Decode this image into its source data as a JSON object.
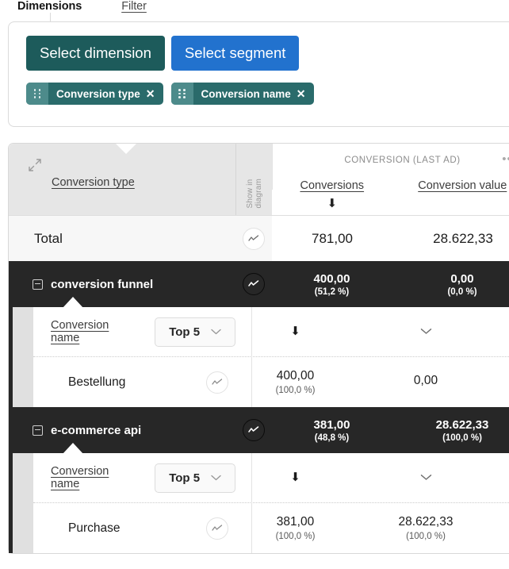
{
  "tabs": {
    "dimensions": "Dimensions",
    "filter": "Filter"
  },
  "panel": {
    "select_dimension": "Select dimension",
    "select_segment": "Select segment",
    "chips": [
      {
        "label": "Conversion type",
        "close": "✕",
        "handle": "drag-handle-icon"
      },
      {
        "label": "Conversion name",
        "close": "✕",
        "handle": "drag-handle-icon"
      }
    ]
  },
  "table": {
    "expand_icon": "expand-diagonal-icon",
    "dimension_header": "Conversion type",
    "show_in_diagram": "Show in\ndiagram",
    "group_header": "CONVERSION (LAST AD)",
    "group_menu": "•••",
    "metrics": [
      {
        "label": "Conversions",
        "sort": "⬇"
      },
      {
        "label": "Conversion value",
        "sort": ""
      }
    ],
    "total_row": {
      "label": "Total",
      "spark": "sparkline-icon",
      "conversions": "781,00",
      "conversion_value": "28.622,33"
    },
    "groups": [
      {
        "name": "conversion funnel",
        "toggle": "collapse-icon",
        "spark": "sparkline-icon",
        "conversions": "400,00",
        "conversions_pct": "(51,2 %)",
        "conversion_value": "0,00",
        "conversion_value_pct": "(0,0 %)",
        "sub_dimension": "Conversion name",
        "top_n": "Top 5",
        "sub_sort_conversions": "⬇",
        "sub_sort_value": "⌄",
        "rows": [
          {
            "label": "Bestellung",
            "spark": "sparkline-icon",
            "conversions": "400,00",
            "conversions_pct": "(100,0 %)",
            "conversion_value": "0,00",
            "conversion_value_pct": ""
          }
        ]
      },
      {
        "name": "e-commerce api",
        "toggle": "collapse-icon",
        "spark": "sparkline-icon",
        "conversions": "381,00",
        "conversions_pct": "(48,8 %)",
        "conversion_value": "28.622,33",
        "conversion_value_pct": "(100,0 %)",
        "sub_dimension": "Conversion name",
        "top_n": "Top 5",
        "sub_sort_conversions": "⬇",
        "sub_sort_value": "⌄",
        "rows": [
          {
            "label": "Purchase",
            "spark": "sparkline-icon",
            "conversions": "381,00",
            "conversions_pct": "(100,0 %)",
            "conversion_value": "28.622,33",
            "conversion_value_pct": "(100,0 %)"
          }
        ]
      }
    ]
  },
  "colors": {
    "teal_button": "#1d5b5b",
    "blue_button": "#2272ce",
    "chip": "#2a6b6b",
    "chip_handle": "#4d8b8b",
    "dark_row": "#272727",
    "header_bg": "#e6e6e6",
    "total_bg": "#f7f7f7"
  }
}
